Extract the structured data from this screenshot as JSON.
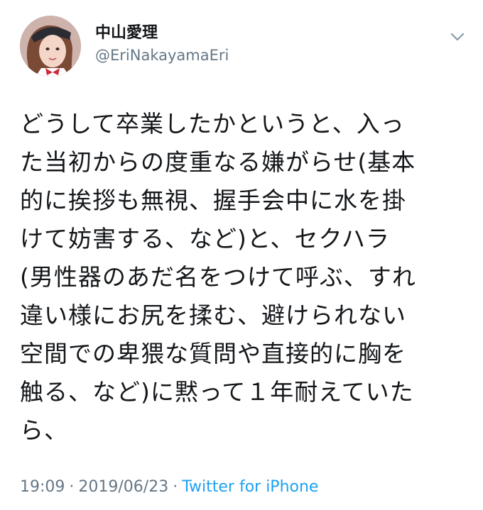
{
  "author": {
    "display_name": "中山愛理",
    "handle": "@EriNakayamaEri"
  },
  "tweet": {
    "lines": [
      "どうして卒業したかというと、入っ",
      "た当初からの度重なる嫌がらせ(基本",
      "的に挨拶も無視、握手会中に水を掛",
      "けて妨害する、など)と、セクハラ",
      "(男性器のあだ名をつけて呼ぶ、すれ",
      "違い様にお尻を揉む、避けられない",
      "空間での卑猥な質問や直接的に胸を",
      "触る、など)に黙って１年耐えていた",
      "ら、"
    ]
  },
  "meta": {
    "time": "19:09",
    "separator": "·",
    "date": "2019/06/23",
    "source": "Twitter for iPhone"
  },
  "icons": {
    "menu": "chevron-down-icon",
    "avatar": "profile-photo"
  },
  "colors": {
    "text": "#14171a",
    "secondary": "#657786",
    "link": "#1da1f2"
  }
}
